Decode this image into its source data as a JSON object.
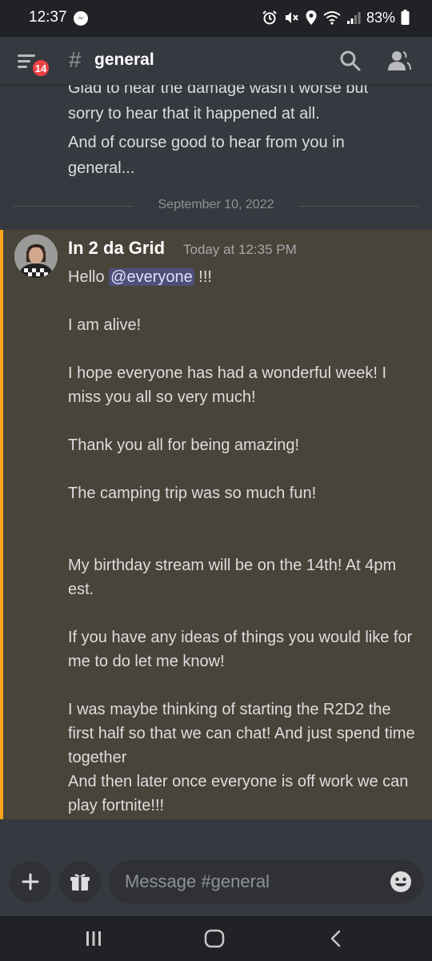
{
  "status_bar": {
    "time": "12:37",
    "battery": "83%"
  },
  "header": {
    "badge_count": "14",
    "channel_name": "general"
  },
  "previous_message": {
    "cut_line": "Glad to hear the damage wasn't worse but",
    "line2": "sorry to hear that it happened at all.",
    "line3": "And of course good to hear from you in",
    "line4": "general..."
  },
  "date_divider": "September 10, 2022",
  "message": {
    "author": "In 2 da Grid",
    "timestamp": "Today at 12:35 PM",
    "greeting": "Hello ",
    "mention": "@everyone",
    "greeting_end": "  !!!",
    "lines": [
      "I am alive!",
      "I hope everyone has had a wonderful  week! I miss you all so very much!",
      "Thank you all for being amazing!",
      "The camping trip was so much fun!",
      "My birthday  stream will be on the 14th! At 4pm est.",
      "If you have any ideas of things you would like for me to do let me know!",
      "I was maybe thinking of starting the R2D2 the first half so that we can chat! And just spend time together",
      "And then later once everyone is off work we can play  fortnite!!!"
    ]
  },
  "composer": {
    "placeholder": "Message #general"
  },
  "colors": {
    "mention_accent": "#faa61a",
    "mention_bg": "#49443a",
    "badge": "#ed4245",
    "background": "#36393f"
  },
  "icons": [
    "messenger-icon",
    "alarm-icon",
    "mute-icon",
    "location-icon",
    "wifi-icon",
    "signal-icon",
    "battery-icon",
    "menu-icon",
    "hash-icon",
    "search-icon",
    "members-icon",
    "plus-icon",
    "gift-icon",
    "emoji-icon",
    "recent-apps-icon",
    "home-icon",
    "back-icon"
  ]
}
